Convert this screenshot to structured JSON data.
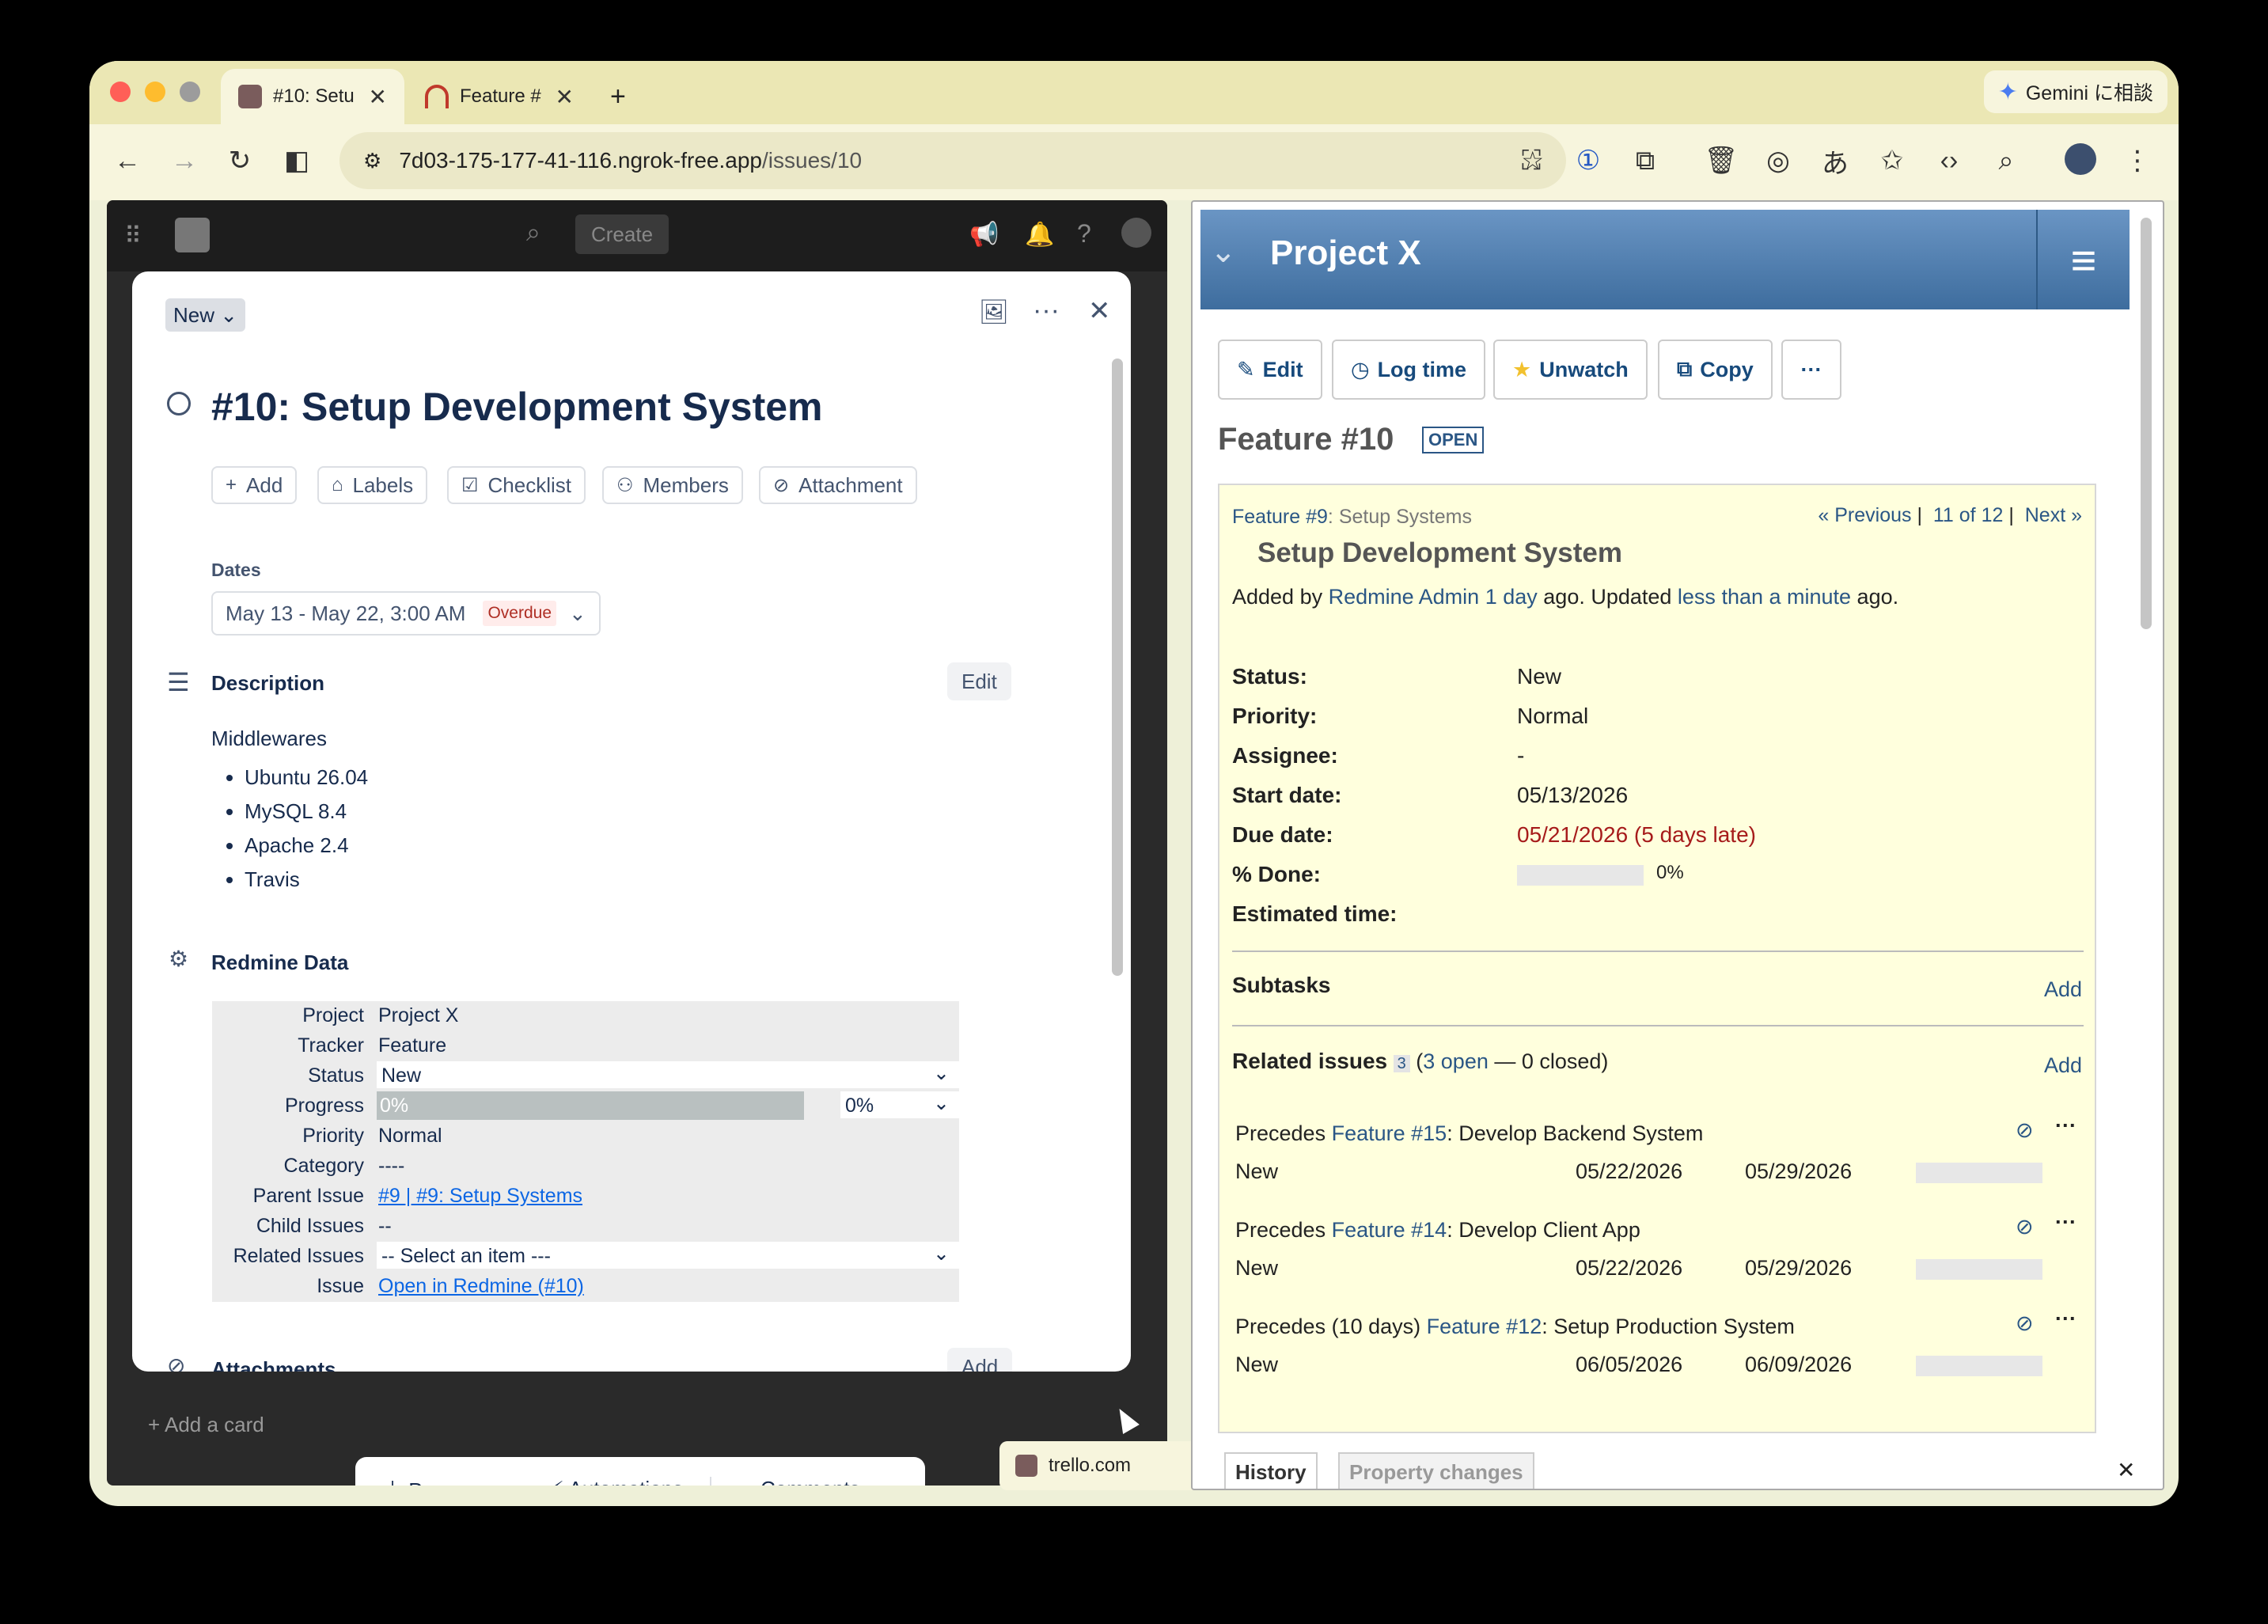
{
  "browser": {
    "tab1_title": "#10: Setu",
    "tab2_title": "Feature #",
    "new_tab": "+",
    "url_host": "7d03-175-177-41-116.ngrok-free.app",
    "url_path": "/issues/10",
    "gemini_label": "Gemini に相談"
  },
  "trello": {
    "top_create": "Create",
    "status_button": "New",
    "card_title": "#10: Setup Development System",
    "actions": [
      "Add",
      "Labels",
      "Checklist",
      "Members",
      "Attachment"
    ],
    "dates_label": "Dates",
    "dates_value": "May 13 - May 22, 3:00 AM",
    "overdue": "Overdue",
    "description_heading": "Description",
    "edit_button": "Edit",
    "description_intro": "Middlewares",
    "description_items": [
      "Ubuntu 26.04",
      "MySQL 8.4",
      "Apache 2.4",
      "Travis"
    ],
    "redmine_heading": "Redmine Data",
    "redmine": {
      "project_k": "Project",
      "project_v": "Project X",
      "tracker_k": "Tracker",
      "tracker_v": "Feature",
      "status_k": "Status",
      "status_v": "New",
      "progress_k": "Progress",
      "progress_v": "0%",
      "progress_select": "0%",
      "priority_k": "Priority",
      "priority_v": "Normal",
      "category_k": "Category",
      "category_v": "----",
      "parent_k": "Parent Issue",
      "parent_v": "#9 | #9: Setup Systems",
      "child_k": "Child Issues",
      "child_v": "--",
      "related_k": "Related Issues",
      "related_v": "-- Select an item ---",
      "issue_k": "Issue",
      "issue_v": "Open in Redmine (#10)"
    },
    "progress_fraction": 0,
    "attachments_heading": "Attachments",
    "attachments_add": "Add",
    "add_card": "Add a card",
    "bottom": {
      "powerups": "Power-ups",
      "automations": "Automations",
      "comments": "Comments"
    },
    "popup_label": "trello.com"
  },
  "redmine": {
    "project_title": "Project X",
    "buttons": {
      "edit": "Edit",
      "log_time": "Log time",
      "unwatch": "Unwatch",
      "copy": "Copy",
      "more": "···"
    },
    "issue_heading": "Feature #10",
    "status_badge": "OPEN",
    "parent_link": "Feature #9",
    "parent_suffix": ": Setup Systems",
    "nav_prev": "« Previous",
    "nav_count": "11 of 12",
    "nav_next": "Next »",
    "subject": "Setup Development System",
    "added_by_prefix": "Added by ",
    "author": "Redmine Admin",
    "added_ago": "1 day",
    "ago_updated": " ago. Updated ",
    "updated_ago": "less than a minute",
    "ago_end": " ago.",
    "fields": {
      "status_k": "Status:",
      "status_v": "New",
      "priority_k": "Priority:",
      "priority_v": "Normal",
      "assignee_k": "Assignee:",
      "assignee_v": "-",
      "start_k": "Start date:",
      "start_v": "05/13/2026",
      "due_k": "Due date:",
      "due_v": "05/21/2026 (5 days late)",
      "done_k": "% Done:",
      "done_v": "0%",
      "estimated_k": "Estimated time:"
    },
    "done_fraction": 0,
    "subtasks_heading": "Subtasks",
    "add_link": "Add",
    "related_heading": "Related issues",
    "related_count": "3",
    "related_open": "3 open",
    "related_closed": " — 0 closed)",
    "related_open_paren": "(",
    "relations": [
      {
        "prefix": "Precedes ",
        "link": "Feature #15",
        "title": ": Develop Backend System",
        "status": "New",
        "start": "05/22/2026",
        "due": "05/29/2026"
      },
      {
        "prefix": "Precedes ",
        "link": "Feature #14",
        "title": ": Develop Client App",
        "status": "New",
        "start": "05/22/2026",
        "due": "05/29/2026"
      },
      {
        "prefix": "Precedes (10 days) ",
        "link": "Feature #12",
        "title": ": Setup Production System",
        "status": "New",
        "start": "06/05/2026",
        "due": "06/09/2026"
      }
    ],
    "tabs": [
      "History",
      "Property changes"
    ]
  },
  "colors": {
    "accent_blue": "#0c66e4",
    "redmine_link": "#2a5685",
    "overdue_red": "#ae2e24",
    "late_red": "#a61b1b",
    "yellow_bg": "#ffffdd"
  }
}
